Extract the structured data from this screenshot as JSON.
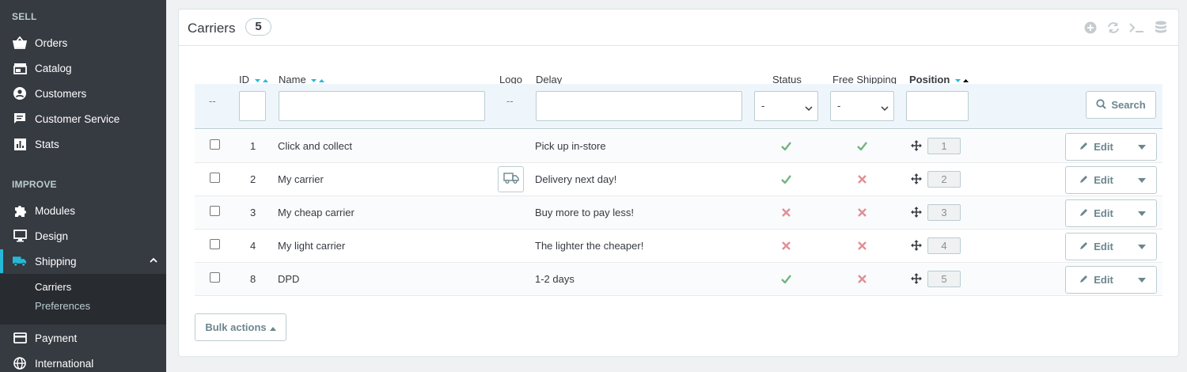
{
  "sidebar": {
    "sell_title": "SELL",
    "improve_title": "IMPROVE",
    "items": [
      {
        "label": "Orders",
        "icon": "basket-icon"
      },
      {
        "label": "Catalog",
        "icon": "store-icon"
      },
      {
        "label": "Customers",
        "icon": "account-circle-icon"
      },
      {
        "label": "Customer Service",
        "icon": "chat-icon"
      },
      {
        "label": "Stats",
        "icon": "bar-chart-icon"
      },
      {
        "label": "Modules",
        "icon": "puzzle-icon"
      },
      {
        "label": "Design",
        "icon": "desktop-icon"
      },
      {
        "label": "Shipping",
        "icon": "truck-icon"
      },
      {
        "label": "Payment",
        "icon": "credit-card-icon"
      },
      {
        "label": "International",
        "icon": "globe-icon"
      }
    ],
    "sub_items": [
      "Carriers",
      "Preferences"
    ],
    "accent": "#25b9d7"
  },
  "panel": {
    "title": "Carriers",
    "count": "5"
  },
  "table": {
    "headers": {
      "id": "ID",
      "name": "Name",
      "logo": "Logo",
      "delay": "Delay",
      "status": "Status",
      "free_shipping": "Free Shipping",
      "position": "Position"
    },
    "filters": {
      "id_dash": "--",
      "logo_dash": "--",
      "status_select": "-",
      "free_select": "-",
      "search_label": "Search"
    },
    "rows": [
      {
        "id": "1",
        "name": "Click and collect",
        "delay": "Pick up in-store",
        "status": "enabled",
        "free": "yes",
        "position": "1",
        "logo": false
      },
      {
        "id": "2",
        "name": "My carrier",
        "delay": "Delivery next day!",
        "status": "enabled",
        "free": "no",
        "position": "2",
        "logo": true
      },
      {
        "id": "3",
        "name": "My cheap carrier",
        "delay": "Buy more to pay less!",
        "status": "disabled",
        "free": "no",
        "position": "3",
        "logo": false
      },
      {
        "id": "4",
        "name": "My light carrier",
        "delay": "The lighter the cheaper!",
        "status": "disabled",
        "free": "no",
        "position": "4",
        "logo": false
      },
      {
        "id": "8",
        "name": "DPD",
        "delay": "1-2 days",
        "status": "enabled",
        "free": "no",
        "position": "5",
        "logo": false
      }
    ],
    "edit_label": "Edit",
    "bulk_label": "Bulk actions",
    "colors": {
      "check": "#70b580",
      "cross": "#e08f95"
    }
  }
}
